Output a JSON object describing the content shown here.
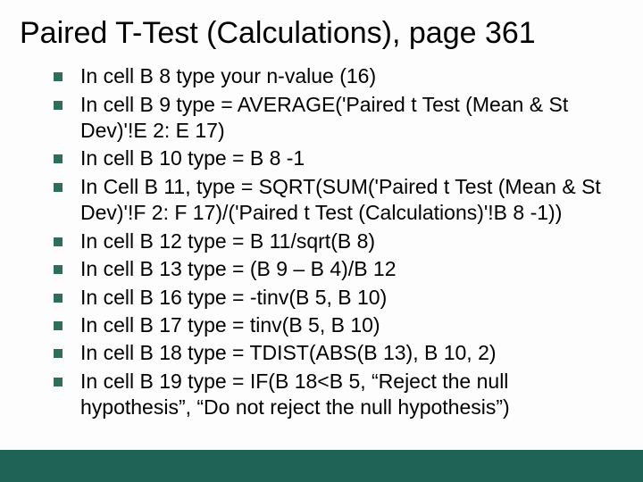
{
  "title": "Paired T-Test (Calculations), page 361",
  "bullets": [
    "In cell B 8 type your n-value (16)",
    "In cell B 9 type = AVERAGE('Paired t Test (Mean & St Dev)'!E 2: E 17)",
    "In cell B 10 type = B 8 -1",
    "In Cell B 11, type = SQRT(SUM('Paired t Test (Mean & St Dev)'!F 2: F 17)/('Paired t Test (Calculations)'!B 8 -1))",
    "In cell B 12 type = B 11/sqrt(B 8)",
    "In cell B 13 type = (B 9 – B 4)/B 12",
    "In cell B 16 type = -tinv(B 5, B 10)",
    "In cell B 17 type = tinv(B 5, B 10)",
    "In cell B 18 type = TDIST(ABS(B 13), B 10, 2)",
    "In cell B 19 type = IF(B 18<B 5, “Reject the null hypothesis”, “Do not reject the null hypothesis”)"
  ]
}
